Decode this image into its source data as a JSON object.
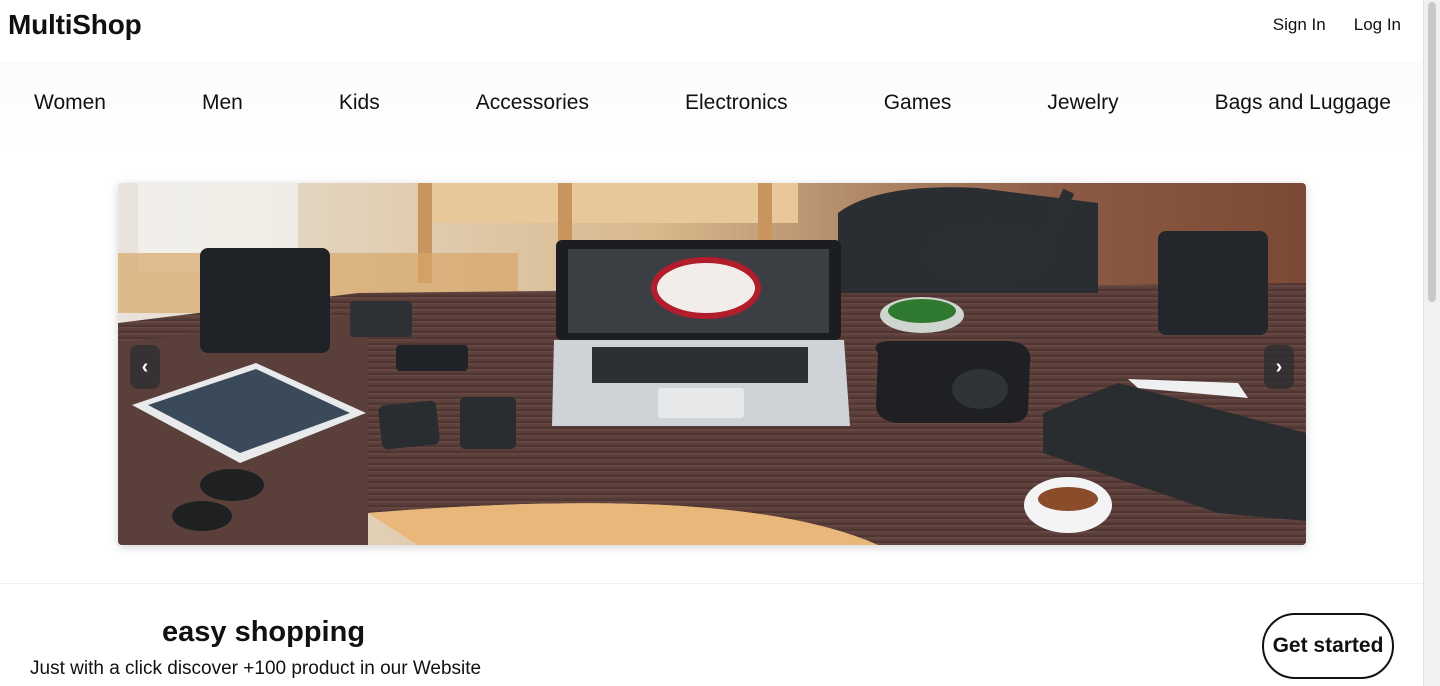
{
  "header": {
    "brand": "MultiShop",
    "sign_in": "Sign In",
    "log_in": "Log In"
  },
  "nav": {
    "items": [
      "Women",
      "Men",
      "Kids",
      "Accessories",
      "Electronics",
      "Games",
      "Jewelry",
      "Bags and Luggage"
    ]
  },
  "hero": {
    "prev_icon": "chevron-left-icon",
    "next_icon": "chevron-right-icon",
    "prev_glyph": "‹",
    "next_glyph": "›",
    "image_subject": "desk with laptop, tablet, phones, speakers and lamp"
  },
  "promo": {
    "title": "easy shopping",
    "subtitle": "Just with a click discover +100 product in our Website",
    "cta_label": "Get started"
  }
}
